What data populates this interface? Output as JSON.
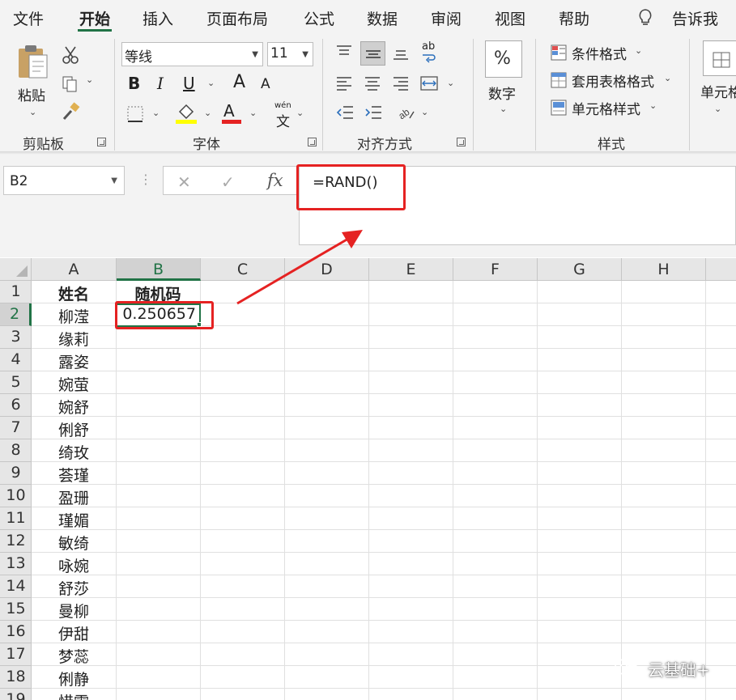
{
  "menu": {
    "tabs": [
      "文件",
      "开始",
      "插入",
      "页面布局",
      "公式",
      "数据",
      "审阅",
      "视图",
      "帮助"
    ],
    "active_tab": "开始",
    "tell_me": "告诉我"
  },
  "ribbon": {
    "clipboard": {
      "paste": "粘贴",
      "group_label": "剪贴板"
    },
    "font": {
      "font_name": "等线",
      "font_size": "11",
      "bold": "B",
      "italic": "I",
      "underline": "U",
      "grow": "A",
      "shrink": "A",
      "font_color": "A",
      "phonetic_top": "wén",
      "phonetic_bottom": "文",
      "group_label": "字体"
    },
    "alignment": {
      "group_label": "对齐方式",
      "wrap_icon": "ab"
    },
    "number": {
      "percent": "%",
      "label": "数字"
    },
    "styles": {
      "conditional": "条件格式",
      "table": "套用表格格式",
      "cell_styles": "单元格样式",
      "group_label": "样式"
    },
    "cells": {
      "label": "单元格"
    }
  },
  "formula_bar": {
    "name_box": "B2",
    "cancel": "✕",
    "enter": "✓",
    "fx": "fx",
    "formula": "=RAND()"
  },
  "sheet": {
    "columns": [
      "A",
      "B",
      "C",
      "D",
      "E",
      "F",
      "G",
      "H"
    ],
    "row_numbers": [
      "1",
      "2",
      "3",
      "4",
      "5",
      "6",
      "7",
      "8",
      "9",
      "10",
      "11",
      "12",
      "13",
      "14",
      "15",
      "16",
      "17",
      "18",
      "19"
    ],
    "header_a": "姓名",
    "header_b": "随机码",
    "b2_value": "0.250657",
    "names": [
      "柳滢",
      "缘莉",
      "露姿",
      "婉萤",
      "婉舒",
      "俐舒",
      "绮玫",
      "荟瑾",
      "盈珊",
      "瑾媚",
      "敏绮",
      "咏婉",
      "舒莎",
      "曼柳",
      "伊甜",
      "梦蕊",
      "俐静",
      "惜霏"
    ]
  },
  "watermark": "云基础+",
  "colors": {
    "accent": "#217346",
    "annotation": "#e52222"
  },
  "icons": [
    "paste-icon",
    "cut-icon",
    "copy-icon",
    "format-painter-icon",
    "border-icon",
    "fill-color-icon",
    "font-color-icon",
    "align-icon",
    "wrap-text-icon",
    "merge-icon",
    "indent-icon",
    "orientation-icon",
    "conditional-format-icon",
    "table-format-icon",
    "cell-style-icon",
    "lightbulb-icon",
    "wechat-icon",
    "arrow-annotation"
  ]
}
